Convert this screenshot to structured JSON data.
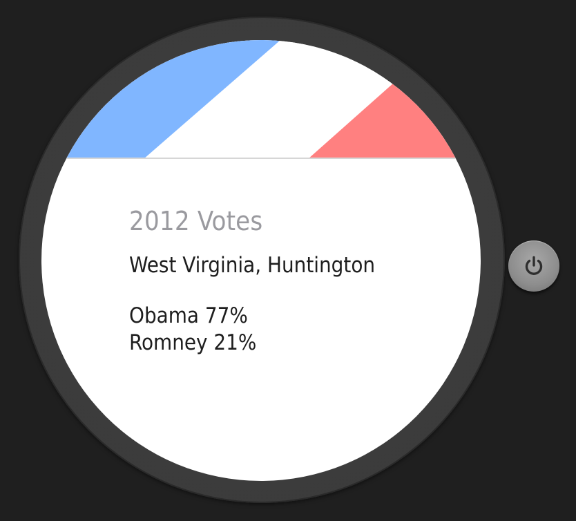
{
  "card": {
    "title": "2012 Votes",
    "location": "West Virginia, Huntington",
    "results": [
      {
        "line": "Obama 77%"
      },
      {
        "line": "Romney 21%"
      }
    ]
  },
  "banner": {
    "colors": {
      "blue": "#80b6ff",
      "white": "#ffffff",
      "red": "#ff8080"
    }
  },
  "device": {
    "power_icon": "power-icon"
  }
}
